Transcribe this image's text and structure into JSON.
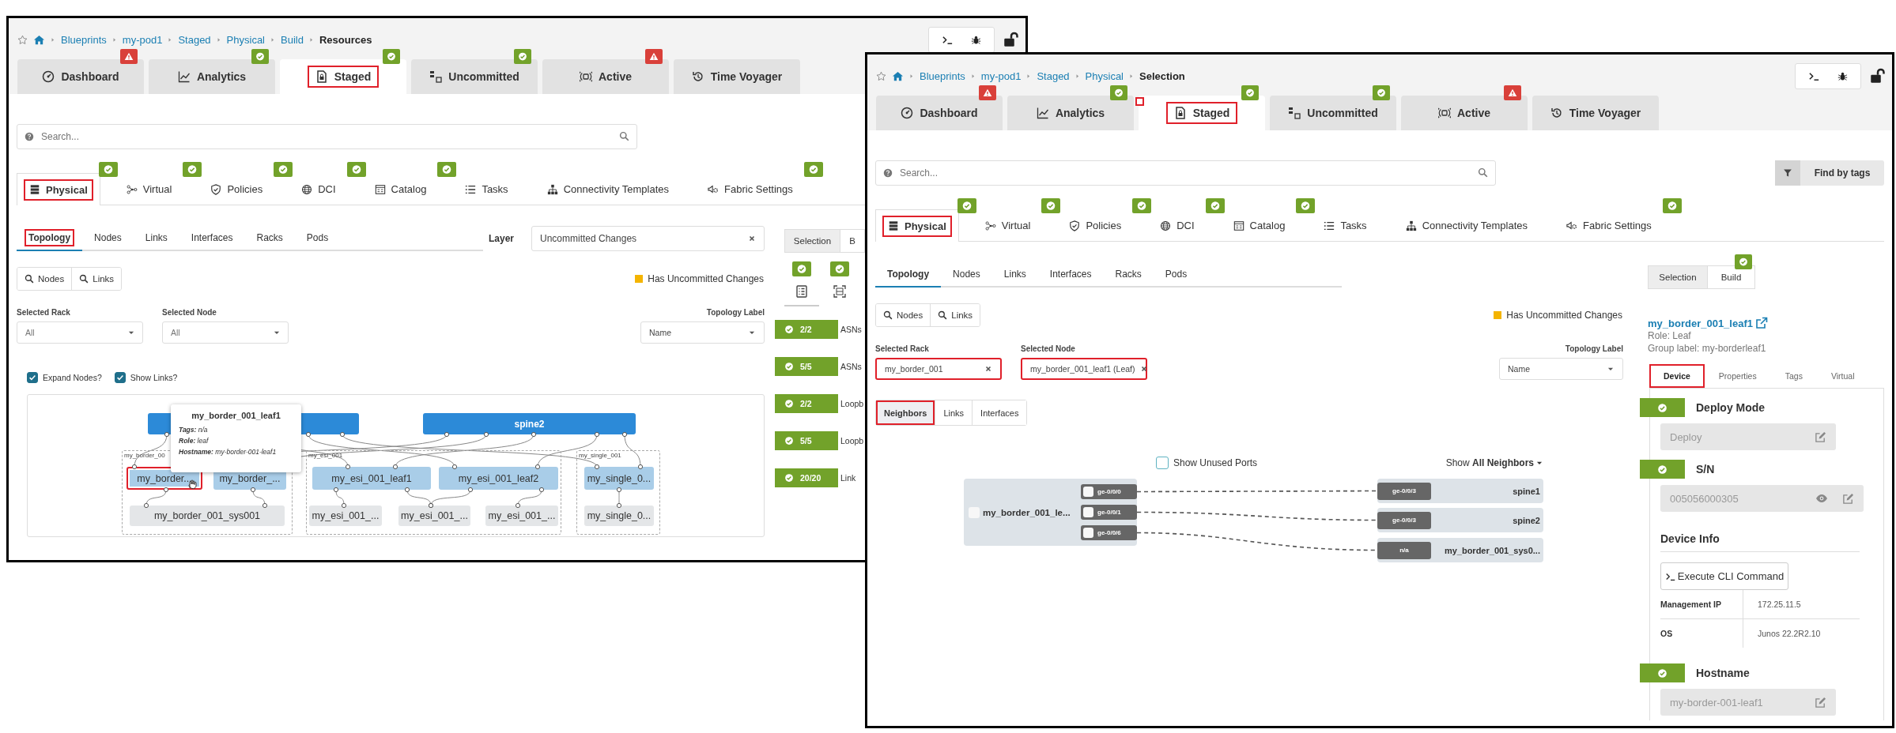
{
  "windows": [
    {
      "kind": "back",
      "breadcrumb": [
        "Blueprints",
        "my-pod1",
        "Staged",
        "Physical",
        "Build"
      ],
      "current_page": "Resources",
      "tabs": [
        {
          "label": "Dashboard",
          "badge": {
            "kind": "warning"
          },
          "selected": false,
          "highlighted": false
        },
        {
          "label": "Analytics",
          "badge": {
            "kind": "ok"
          },
          "selected": false,
          "highlighted": false
        },
        {
          "label": "Staged",
          "badge": {
            "kind": "ok"
          },
          "selected": true,
          "highlighted": true
        },
        {
          "label": "Uncommitted",
          "badge": {
            "kind": "ok"
          },
          "selected": false,
          "highlighted": false
        },
        {
          "label": "Active",
          "badge": {
            "kind": "warning"
          },
          "selected": false,
          "highlighted": false
        },
        {
          "label": "Time Voyager",
          "selected": false,
          "highlighted": false
        }
      ],
      "search": {
        "placeholder": "Search..."
      },
      "section_tabs": [
        {
          "label": "Physical",
          "badge": {
            "kind": "ok"
          },
          "selected": true,
          "highlighted": true
        },
        {
          "label": "Virtual",
          "badge": {
            "kind": "ok"
          },
          "selected": false,
          "highlighted": false
        },
        {
          "label": "Policies",
          "badge": {
            "kind": "ok"
          },
          "selected": false,
          "highlighted": false
        },
        {
          "label": "DCI",
          "badge": {
            "kind": "ok"
          },
          "selected": false,
          "highlighted": false
        },
        {
          "label": "Catalog",
          "badge": {
            "kind": "ok"
          },
          "selected": false,
          "highlighted": false
        },
        {
          "label": "Tasks",
          "selected": false,
          "highlighted": false
        },
        {
          "label": "Connectivity Templates",
          "selected": false,
          "highlighted": false
        },
        {
          "label": "Fabric Settings",
          "badge": {
            "kind": "ok"
          },
          "selected": false,
          "highlighted": false
        }
      ],
      "view_tabs": [
        {
          "label": "Topology",
          "selected": true,
          "highlighted": true
        },
        {
          "label": "Nodes",
          "selected": false,
          "highlighted": false
        },
        {
          "label": "Links",
          "selected": false,
          "highlighted": false
        },
        {
          "label": "Interfaces",
          "selected": false,
          "highlighted": false
        },
        {
          "label": "Racks",
          "selected": false,
          "highlighted": false
        },
        {
          "label": "Pods",
          "selected": false,
          "highlighted": false
        }
      ],
      "layer": {
        "label": "Layer",
        "value": "Uncommitted Changes"
      },
      "find_buttons": [
        "Nodes",
        "Links"
      ],
      "legend": "Has Uncommitted Changes",
      "filters": [
        {
          "label": "Selected Rack",
          "placeholder": "All",
          "highlighted": false
        },
        {
          "label": "Selected Node",
          "placeholder": "All",
          "highlighted": false
        }
      ],
      "topology_label": {
        "label": "Topology Label",
        "value": "Name"
      },
      "options": [
        {
          "label": "Expand Nodes?",
          "checked": true
        },
        {
          "label": "Show Links?",
          "checked": true
        }
      ],
      "graph": {
        "spines": [
          {
            "kind": "covered"
          },
          {
            "kind": "labeled",
            "label": "spine2"
          }
        ],
        "groups": [
          {
            "label": "my_border_00",
            "leaves": [
              {
                "label": "my_border...",
                "selected": true
              },
              {
                "label": "my_border_...",
                "selected": false
              }
            ],
            "systems": [
              "my_border_001_sys001"
            ]
          },
          {
            "label": "my_esi_001",
            "leaves": [
              {
                "label": "my_esi_001_leaf1",
                "selected": false
              },
              {
                "label": "my_esi_001_leaf2",
                "selected": false
              }
            ],
            "systems": [
              "my_esi_001_...",
              "my_esi_001_...",
              "my_esi_001_..."
            ]
          },
          {
            "label": "my_single_001",
            "leaves": [
              {
                "label": "my_single_0...",
                "selected": false
              }
            ],
            "systems": [
              "my_single_0..."
            ]
          }
        ],
        "tooltip": {
          "title": "my_border_001_leaf1",
          "rows": [
            "**Tags:** n/a",
            "**Role:** leaf",
            "**Hostname:** my-border-001-leaf1"
          ]
        }
      },
      "toggle": [
        {
          "label": "Selection",
          "selected": true
        },
        {
          "label": "B",
          "selected": false
        }
      ],
      "icon_tabs": [
        {
          "badge": {
            "kind": "ok"
          },
          "selected": true
        },
        {
          "badge": {
            "kind": "ok"
          },
          "selected": false
        }
      ],
      "checks": [
        {
          "count": "2/2",
          "label": "ASNs"
        },
        {
          "count": "5/5",
          "label": "ASNs"
        },
        {
          "count": "2/2",
          "label": "Loopb"
        },
        {
          "count": "5/5",
          "label": "Loopb"
        },
        {
          "count": "20/20",
          "label": "Link"
        }
      ]
    },
    {
      "kind": "front",
      "breadcrumb": [
        "Blueprints",
        "my-pod1",
        "Staged",
        "Physical"
      ],
      "current_page": "Selection",
      "tabs": [
        {
          "label": "Dashboard",
          "badge": {
            "kind": "warning"
          },
          "selected": false,
          "highlighted": false
        },
        {
          "label": "Analytics",
          "badge": {
            "kind": "ok"
          },
          "selected": false,
          "highlighted": false
        },
        {
          "label": "Staged",
          "badge": {
            "kind": "ok"
          },
          "selected": true,
          "highlighted": true
        },
        {
          "label": "Uncommitted",
          "badge": {
            "kind": "ok"
          },
          "selected": false,
          "highlighted": false
        },
        {
          "label": "Active",
          "badge": {
            "kind": "warning"
          },
          "selected": false,
          "highlighted": false
        },
        {
          "label": "Time Voyager",
          "selected": false,
          "highlighted": false
        }
      ],
      "search": {
        "placeholder": "Search..."
      },
      "find_by_tags": "Find by tags",
      "section_tabs": [
        {
          "label": "Physical",
          "badge": {
            "kind": "ok"
          },
          "selected": true,
          "highlighted": true
        },
        {
          "label": "Virtual",
          "badge": {
            "kind": "ok"
          },
          "selected": false,
          "highlighted": false
        },
        {
          "label": "Policies",
          "badge": {
            "kind": "ok"
          },
          "selected": false,
          "highlighted": false
        },
        {
          "label": "DCI",
          "badge": {
            "kind": "ok"
          },
          "selected": false,
          "highlighted": false
        },
        {
          "label": "Catalog",
          "badge": {
            "kind": "ok"
          },
          "selected": false,
          "highlighted": false
        },
        {
          "label": "Tasks",
          "selected": false,
          "highlighted": false
        },
        {
          "label": "Connectivity Templates",
          "selected": false,
          "highlighted": false
        },
        {
          "label": "Fabric Settings",
          "badge": {
            "kind": "ok"
          },
          "selected": false,
          "highlighted": false
        }
      ],
      "view_tabs": [
        {
          "label": "Topology",
          "selected": true,
          "highlighted": false
        },
        {
          "label": "Nodes",
          "selected": false,
          "highlighted": false
        },
        {
          "label": "Links",
          "selected": false,
          "highlighted": false
        },
        {
          "label": "Interfaces",
          "selected": false,
          "highlighted": false
        },
        {
          "label": "Racks",
          "selected": false,
          "highlighted": false
        },
        {
          "label": "Pods",
          "selected": false,
          "highlighted": false
        }
      ],
      "find_buttons": [
        "Nodes",
        "Links"
      ],
      "legend": "Has Uncommitted Changes",
      "filters": [
        {
          "label": "Selected Rack",
          "value": "my_border_001",
          "highlighted": true
        },
        {
          "label": "Selected Node",
          "value": "my_border_001_leaf1 (Leaf)",
          "highlighted": true
        }
      ],
      "topology_label": {
        "label": "Topology Label",
        "value": "Name"
      },
      "subview_tabs": [
        {
          "label": "Neighbors",
          "selected": true,
          "highlighted": true
        },
        {
          "label": "Links",
          "selected": false,
          "highlighted": false
        },
        {
          "label": "Interfaces",
          "selected": false,
          "highlighted": false
        }
      ],
      "unused_ports": {
        "label": "Show Unused Ports",
        "checked": false
      },
      "neighbor_filter": "Show **All Neighbors**",
      "neighbors": {
        "node": "my_border_001_le...",
        "checked": false,
        "links": [
          {
            "local_port": "ge-0/0/0",
            "checked": false,
            "remote_port": "ge-0/0/3",
            "remote": "spine1"
          },
          {
            "local_port": "ge-0/0/1",
            "checked": false,
            "remote_port": "ge-0/0/3",
            "remote": "spine2"
          },
          {
            "local_port": "ge-0/0/6",
            "checked": false,
            "remote_port": "n/a",
            "remote": "my_border_001_sys0..."
          }
        ]
      },
      "toggle": [
        {
          "label": "Selection",
          "selected": true
        },
        {
          "label": "Build",
          "selected": false,
          "badge": {
            "kind": "ok"
          }
        }
      ],
      "details": {
        "title": "my_border_001_leaf1",
        "role": "Role: Leaf",
        "group_label": "Group label: my-borderleaf1",
        "tabs": [
          {
            "label": "Device",
            "selected": true,
            "highlighted": true
          },
          {
            "label": "Properties",
            "selected": false,
            "highlighted": false
          },
          {
            "label": "Tags",
            "selected": false,
            "highlighted": false
          },
          {
            "label": "Virtual",
            "selected": false,
            "highlighted": false
          }
        ],
        "sections": [
          {
            "kind": "field",
            "badge": {
              "kind": "ok"
            },
            "title": "Deploy Mode",
            "value": "Deploy",
            "revealable": false
          },
          {
            "kind": "field",
            "badge": {
              "kind": "ok"
            },
            "title": "S/N",
            "value": "005056000305",
            "revealable": true
          },
          {
            "kind": "info",
            "title": "Device Info",
            "button": "Execute CLI Command",
            "rows": [
              {
                "key": "Management IP",
                "value": "172.25.11.5"
              },
              {
                "key": "OS",
                "value": "Junos 22.2R2.10"
              }
            ]
          },
          {
            "kind": "field",
            "badge": {
              "kind": "ok"
            },
            "title": "Hostname",
            "value": "my-border-001-leaf1",
            "revealable": false
          }
        ]
      }
    }
  ]
}
